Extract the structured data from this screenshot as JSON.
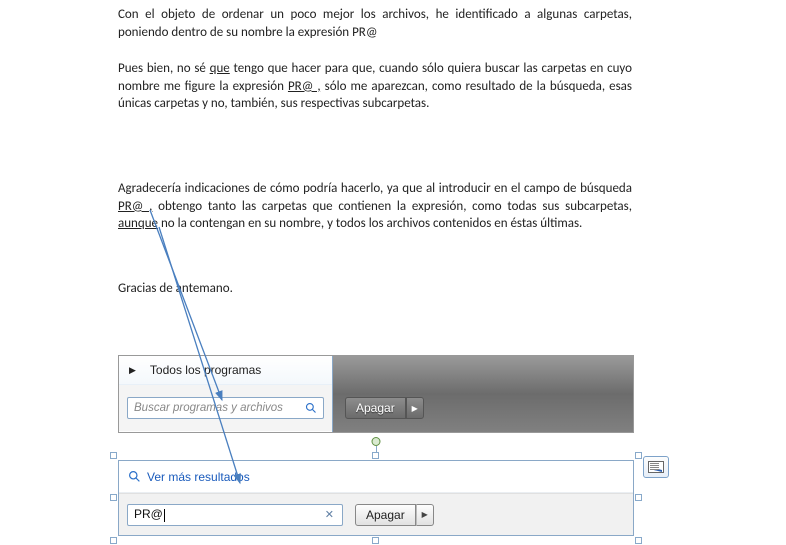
{
  "paragraphs": {
    "p1_a": "Con el objeto de ordenar un poco mejor los archivos, he identificado a algunas carpetas, poniendo dentro de su nombre la expresión ",
    "p1_b": "PR@",
    "p2_a": "Pues bien, no sé ",
    "p2_b": "que",
    "p2_c": " tengo que hacer para que, cuando sólo quiera buscar las carpetas en cuyo nombre me figure la expresión ",
    "p2_d": "PR@ ,",
    "p2_e": " sólo me aparezcan, como resultado de la búsqueda, esas únicas carpetas  y no, también, sus respectivas subcarpetas.",
    "p3_a": "Agradecería indicaciones de cómo podría hacerlo, ya que al introducir en el campo de búsqueda ",
    "p3_b": "PR@ ,",
    "p3_c": " obtengo tanto las carpetas que contienen la expresión, como todas sus subcarpetas, ",
    "p3_d": "aunque",
    "p3_e": " no la contengan en su nombre, y todos los archivos contenidos en éstas últimas.",
    "p4": "Gracias de antemano."
  },
  "start_menu": {
    "all_programs": "Todos los programas",
    "search_placeholder": "Buscar programas y archivos",
    "shutdown": "Apagar"
  },
  "search_popup": {
    "more_results": "Ver más resultados",
    "input_value": "PR@",
    "shutdown": "Apagar"
  }
}
